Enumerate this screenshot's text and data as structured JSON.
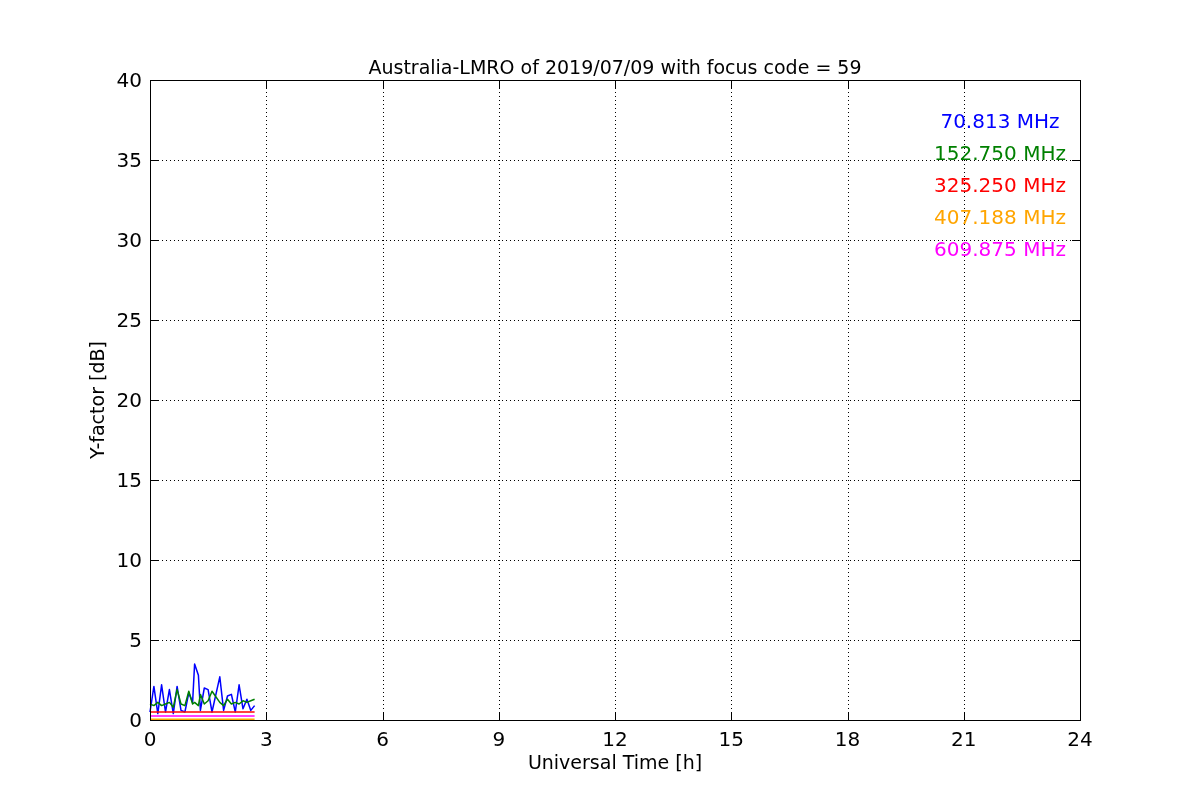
{
  "chart": {
    "chart_data": {
      "type": "line",
      "title": "Australia-LMRO of 2019/07/09 with focus code = 59",
      "xlabel": "Universal Time [h]",
      "ylabel": "Y-factor [dB]",
      "x": [
        0,
        0.1,
        0.2,
        0.3,
        0.4,
        0.5,
        0.6,
        0.7,
        0.8,
        0.9,
        1.0,
        1.1,
        1.15,
        1.25,
        1.3,
        1.4,
        1.5,
        1.6,
        1.8,
        1.9,
        2.0,
        2.1,
        2.2,
        2.3,
        2.4,
        2.5,
        2.6,
        2.7
      ],
      "series": [
        {
          "name": "70.813 MHz",
          "color": "#0000ff",
          "values": [
            0.5,
            2.1,
            0.4,
            2.2,
            0.5,
            1.9,
            0.4,
            2.1,
            0.6,
            0.5,
            1.7,
            1.1,
            3.5,
            2.8,
            0.6,
            2.0,
            1.9,
            0.5,
            2.7,
            0.6,
            1.5,
            1.6,
            0.5,
            2.2,
            0.7,
            1.3,
            0.6,
            0.9
          ]
        },
        {
          "name": "152.750 MHz",
          "color": "#008000",
          "values": [
            1.0,
            0.9,
            1.1,
            0.9,
            1.0,
            1.1,
            0.8,
            1.9,
            1.0,
            0.9,
            1.8,
            1.0,
            1.1,
            0.9,
            1.6,
            1.0,
            1.2,
            1.8,
            1.1,
            0.9,
            1.3,
            1.0,
            1.1,
            1.0,
            1.2,
            1.1,
            1.2,
            1.3
          ]
        },
        {
          "name": "325.250 MHz",
          "color": "#ff0000",
          "values": [
            0.5,
            0.5,
            0.5,
            0.5,
            0.5,
            0.5,
            0.5,
            0.5,
            0.5,
            0.5,
            0.5,
            0.5,
            0.5,
            0.5,
            0.5,
            0.5,
            0.5,
            0.5,
            0.5,
            0.5,
            0.5,
            0.5,
            0.5,
            0.5,
            0.5,
            0.5,
            0.5,
            0.5
          ]
        },
        {
          "name": "407.188 MHz",
          "color": "#ffa500",
          "values": [
            0.05,
            0.05,
            0.05,
            0.05,
            0.05,
            0.05,
            0.05,
            0.05,
            0.05,
            0.05,
            0.05,
            0.05,
            0.05,
            0.05,
            0.05,
            0.05,
            0.05,
            0.05,
            0.05,
            0.05,
            0.05,
            0.05,
            0.05,
            0.05,
            0.05,
            0.05,
            0.05,
            0.05
          ]
        },
        {
          "name": "609.875 MHz",
          "color": "#ff00ff",
          "values": [
            0.25,
            0.25,
            0.25,
            0.25,
            0.25,
            0.25,
            0.25,
            0.25,
            0.25,
            0.25,
            0.25,
            0.25,
            0.25,
            0.25,
            0.25,
            0.25,
            0.25,
            0.25,
            0.25,
            0.25,
            0.25,
            0.25,
            0.25,
            0.25,
            0.25,
            0.25,
            0.25,
            0.25
          ]
        }
      ],
      "grid": true,
      "xlim": [
        0,
        24
      ],
      "ylim": [
        0,
        40
      ],
      "xticks": [
        0,
        3,
        6,
        9,
        12,
        15,
        18,
        21,
        24
      ],
      "yticks": [
        0,
        5,
        10,
        15,
        20,
        25,
        30,
        35,
        40
      ]
    }
  }
}
